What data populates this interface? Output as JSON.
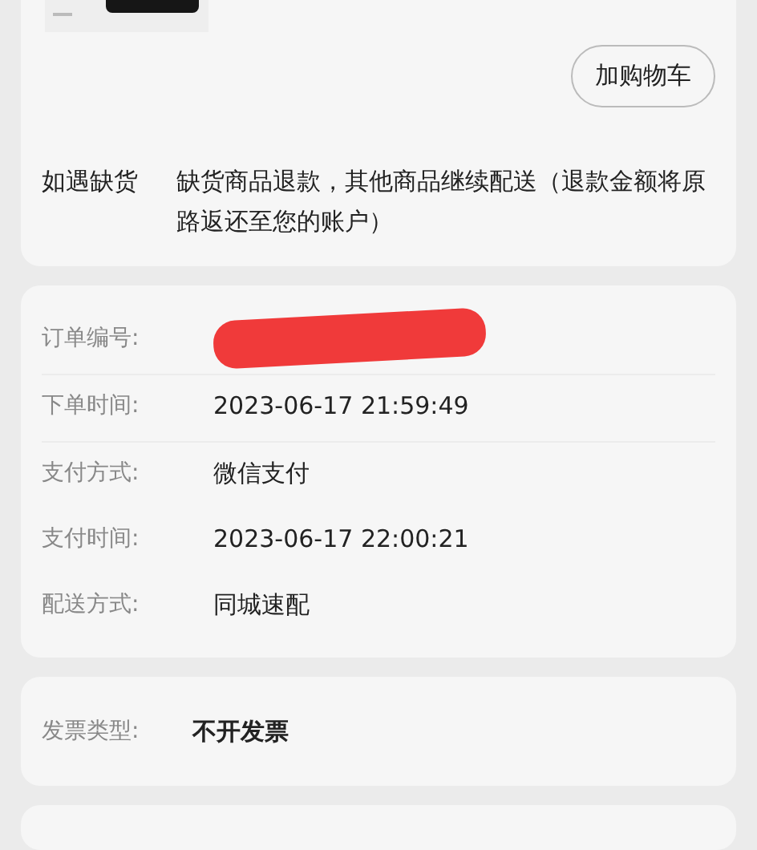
{
  "product_card": {
    "add_to_cart_button": "加购物车",
    "stockout": {
      "label": "如遇缺货",
      "text": "缺货商品退款，其他商品继续配送（退款金额将原路返还至您的账户）"
    }
  },
  "order_info": {
    "rows": [
      {
        "label": "订单编号:",
        "value": null,
        "redacted": true,
        "divider": false
      },
      {
        "label": "下单时间:",
        "value": "2023-06-17 21:59:49",
        "redacted": false,
        "divider": true
      },
      {
        "label": "支付方式:",
        "value": "微信支付",
        "redacted": false,
        "divider": true
      },
      {
        "label": "支付时间:",
        "value": "2023-06-17 22:00:21",
        "redacted": false,
        "divider": false
      },
      {
        "label": "配送方式:",
        "value": "同城速配",
        "redacted": false,
        "divider": false
      }
    ]
  },
  "invoice": {
    "label": "发票类型:",
    "value": "不开发票"
  }
}
